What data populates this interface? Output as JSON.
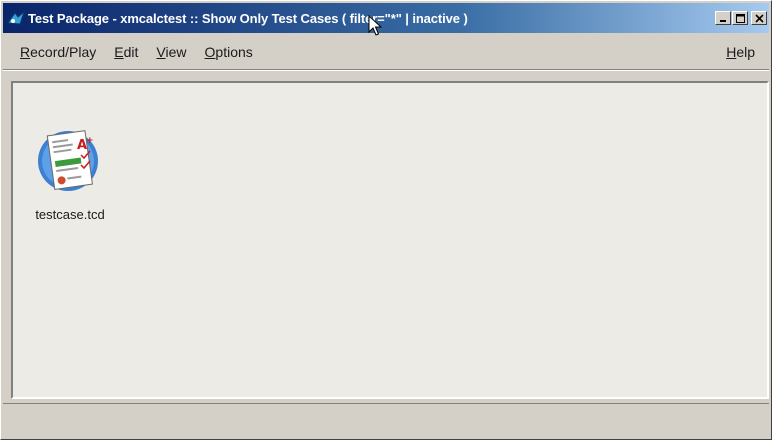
{
  "window": {
    "title": "Test Package - xmcalctest :: Show Only Test Cases  ( filter=\"*\"  | inactive )"
  },
  "title_buttons": {
    "minimize": "_",
    "maximize": "□",
    "close": "×"
  },
  "menu": {
    "items": [
      {
        "label_pre": "",
        "mnemonic": "R",
        "label_post": "ecord/Play"
      },
      {
        "label_pre": "",
        "mnemonic": "E",
        "label_post": "dit"
      },
      {
        "label_pre": "",
        "mnemonic": "V",
        "label_post": "iew"
      },
      {
        "label_pre": "",
        "mnemonic": "O",
        "label_post": "ptions"
      }
    ],
    "help": {
      "label_pre": "",
      "mnemonic": "H",
      "label_post": "elp"
    }
  },
  "content": {
    "files": [
      {
        "name": "testcase.tcd",
        "icon": "test-document-icon"
      }
    ]
  },
  "colors": {
    "titlebar_start": "#0a246a",
    "titlebar_end": "#a6caf0",
    "window_bg": "#d4d0c8",
    "content_bg": "#ecebe5"
  }
}
